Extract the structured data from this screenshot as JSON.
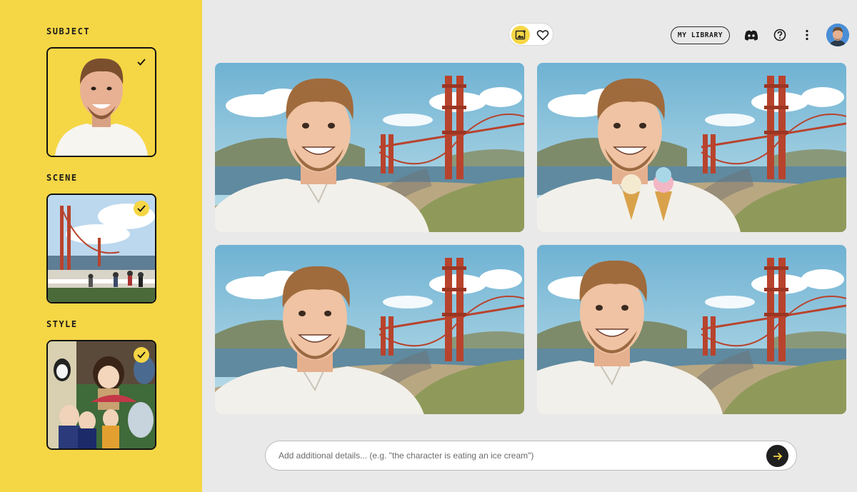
{
  "sidebar": {
    "sections": [
      {
        "label": "SUBJECT",
        "selected": true,
        "check_style": "plain",
        "thumbnail": "man-portrait"
      },
      {
        "label": "SCENE",
        "selected": true,
        "check_style": "filled",
        "thumbnail": "golden-gate-photo"
      },
      {
        "label": "STYLE",
        "selected": true,
        "check_style": "filled",
        "thumbnail": "anime-characters"
      }
    ]
  },
  "topbar": {
    "toggle": [
      "image-icon",
      "heart-icon"
    ],
    "library_label": "MY LIBRARY",
    "icons": [
      "discord-icon",
      "help-icon",
      "more-vert-icon"
    ],
    "avatar": "user-avatar"
  },
  "results": [
    {
      "pose": "smiling-selfie"
    },
    {
      "pose": "holding-ice-creams"
    },
    {
      "pose": "selfie-arm-out"
    },
    {
      "pose": "surprised"
    }
  ],
  "prompt": {
    "placeholder": "Add additional details... (e.g. \"the character is eating an ice cream\")",
    "value": ""
  },
  "colors": {
    "accent": "#f5d645",
    "background": "#e9e9e9",
    "bridge": "#b8432d",
    "sky": "#8cc4dc"
  }
}
